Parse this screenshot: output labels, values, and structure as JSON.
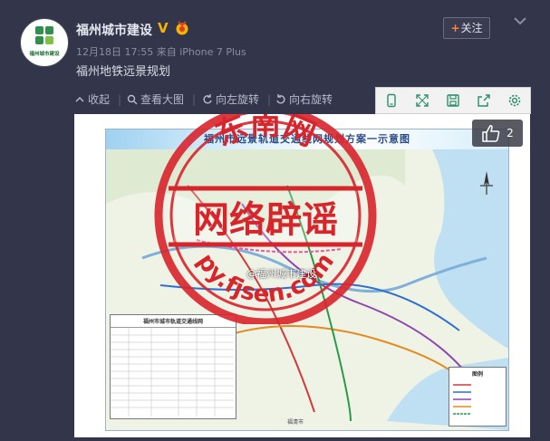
{
  "post": {
    "author": "福州城市建设",
    "avatar_text": "福州城市建设",
    "time": "12月18日 17:55",
    "source_prefix": "来自",
    "source": "iPhone 7 Plus",
    "text": "福州地铁远景规划",
    "follow_label": "关注"
  },
  "toolbar": {
    "collapse": "收起",
    "view_large": "查看大图",
    "rotate_left": "向左旋转",
    "rotate_right": "向右旋转"
  },
  "image": {
    "like_count": "2",
    "map_title": "福州市远景轨道交通线网规划方案一示意图",
    "table_title": "福州市城市轨道交通线网",
    "legend_title": "图例",
    "stamp_top": "东南网",
    "stamp_center": "网络辟谣",
    "stamp_bottom": "py.fjsen.com",
    "watermark": "@福州城市建设",
    "bottom_place": "福清市"
  },
  "colors": {
    "accent": "#ff8140",
    "stamp_red": "#d8242b",
    "verified": "#f5b400"
  }
}
